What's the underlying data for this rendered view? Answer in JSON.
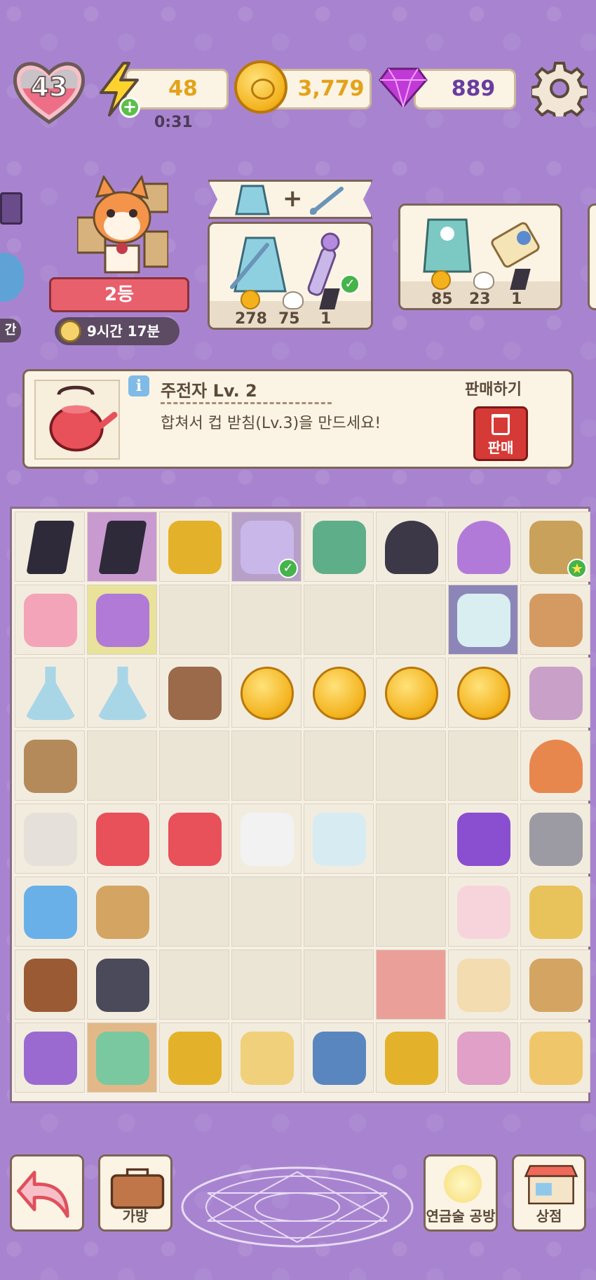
{
  "header": {
    "level": "43",
    "energy": "48",
    "energy_timer": "0:31",
    "coins": "3,779",
    "gems": "889"
  },
  "rank": {
    "place": "2등",
    "time_left": "9시간 17분"
  },
  "left_edge_label": "간",
  "orders": [
    {
      "counts": [
        "278",
        "75",
        "1"
      ]
    },
    {
      "counts": [
        "85",
        "23",
        "1"
      ]
    }
  ],
  "item_info": {
    "title": "주전자 Lv. 2",
    "description": "합쳐서 컵 받침(Lv.3)을 만드세요!",
    "sell_title": "판매하기",
    "sell_label": "판매"
  },
  "board": {
    "rows": [
      [
        "card-dark",
        "card-dark-2",
        "crown",
        "wand-selected",
        "dino",
        "mushroom-dark",
        "mushroom-purple",
        "scissors"
      ],
      [
        "flower-pink",
        "flower-purple",
        "",
        "",
        "",
        "",
        "bowl",
        "cutting-board"
      ],
      [
        "potion-clear",
        "potion-feather",
        "brush",
        "coins-2",
        "coins-4",
        "coins-3",
        "coin-1",
        "needle"
      ],
      [
        "branch",
        "",
        "",
        "",
        "",
        "",
        "",
        "mushroom-house"
      ],
      [
        "cup-glass",
        "mug",
        "kettle",
        "plate",
        "goblet",
        "",
        "crystal-rock",
        "rock"
      ],
      [
        "mirror",
        "harp",
        "",
        "",
        "",
        "",
        "paw-gloves",
        "kitchen-cart"
      ],
      [
        "collar",
        "vest",
        "",
        "",
        "",
        "",
        "scroll",
        "toy-cart"
      ],
      [
        "chest-purple",
        "chest-green",
        "chest-gold",
        "cabinet",
        "wardrobe",
        "treasure",
        "bath",
        "bones-cart"
      ]
    ]
  },
  "bottom": {
    "bag_label": "가방",
    "alchemy_label": "연금술 공방",
    "shop_label": "상점"
  }
}
